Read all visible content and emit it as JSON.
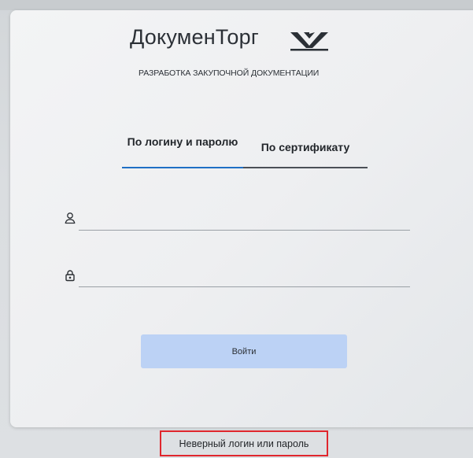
{
  "logo": {
    "title": "ДокуменТорг",
    "subtitle": "РАЗРАБОТКА ЗАКУПОЧНОЙ ДОКУМЕНТАЦИИ"
  },
  "tabs": [
    {
      "label": "По логину и паролю",
      "active": true
    },
    {
      "label": "По сертификату",
      "active": false
    }
  ],
  "form": {
    "login_value": "",
    "password_value": "",
    "submit_label": "Войти"
  },
  "error_message": "Неверный логин или пароль",
  "colors": {
    "accent": "#1f6fc5",
    "button_bg": "#bcd2f5",
    "error_border": "#e0262d"
  }
}
